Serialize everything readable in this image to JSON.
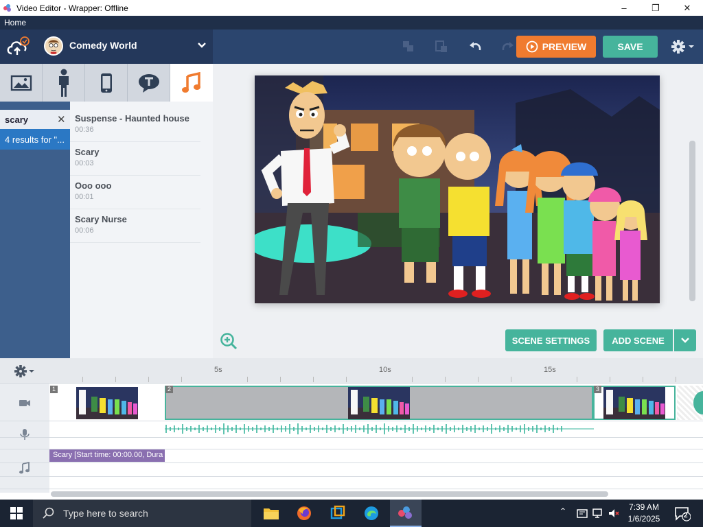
{
  "window": {
    "title": "Video Editor - Wrapper: Offline"
  },
  "menu": {
    "home": "Home"
  },
  "project": {
    "title": "Comedy World"
  },
  "toolbar": {
    "preview_label": "PREVIEW",
    "save_label": "SAVE"
  },
  "library": {
    "search_value": "scary",
    "results_text": "4 results for \"...",
    "tracks": [
      {
        "name": "Suspense - Haunted house",
        "duration": "00:36"
      },
      {
        "name": "Scary",
        "duration": "00:03"
      },
      {
        "name": "Ooo ooo",
        "duration": "00:01"
      },
      {
        "name": "Scary Nurse",
        "duration": "00:06"
      }
    ]
  },
  "stage": {
    "scene_settings_label": "SCENE SETTINGS",
    "add_scene_label": "ADD SCENE"
  },
  "timeline": {
    "ruler_labels": [
      "5s",
      "10s",
      "15s"
    ],
    "scene_numbers": [
      "1",
      "2",
      "3"
    ],
    "music_clip": "Scary [Start time: 00:00.00, Dura"
  },
  "taskbar": {
    "search_placeholder": "Type here to search",
    "time": "7:39 AM",
    "date": "1/6/2025",
    "notification_count": "2"
  },
  "colors": {
    "accent_green": "#46b49c",
    "preview_orange": "#f07b2f",
    "topbar": "#2b456e",
    "sidebar_blue": "#3d5f8c"
  }
}
